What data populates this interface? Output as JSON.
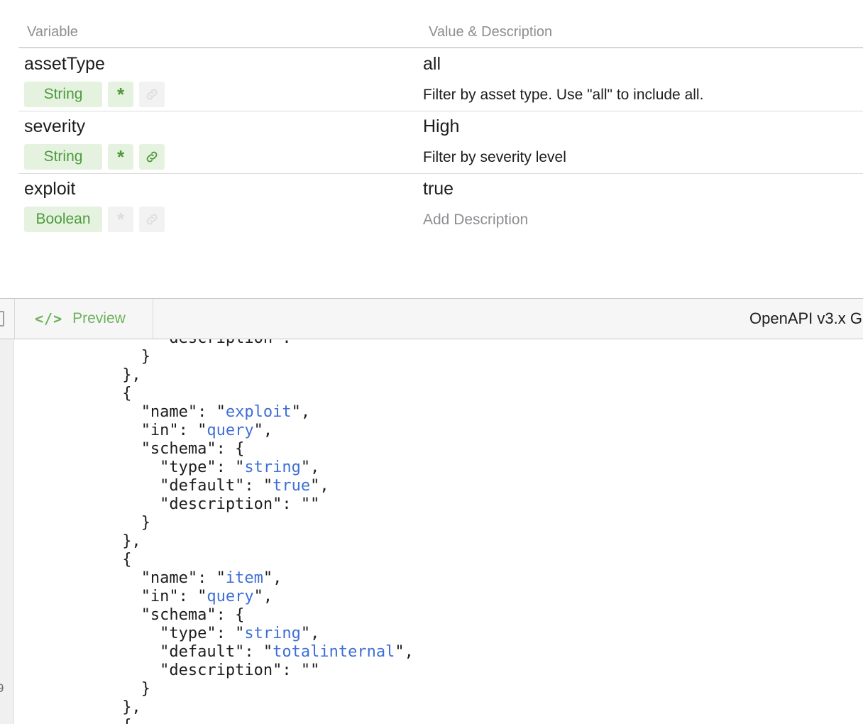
{
  "table": {
    "header_variable": "Variable",
    "header_value": "Value & Description",
    "rows": [
      {
        "name": "assetType",
        "value": "all",
        "type": "String",
        "required": true,
        "linked": false,
        "description": "Filter by asset type. Use \"all\" to include all."
      },
      {
        "name": "severity",
        "value": "High",
        "type": "String",
        "required": true,
        "linked": true,
        "description": "Filter by severity level"
      },
      {
        "name": "exploit",
        "value": "true",
        "type": "Boolean",
        "required": false,
        "linked": false,
        "description": "Add Description"
      }
    ]
  },
  "tabs": {
    "preview_label": "Preview",
    "format_label": "OpenAPI v3.x G"
  },
  "editor": {
    "gutter_number": "9",
    "lines": [
      {
        "indent": 8,
        "key": "description",
        "suffix": ":"
      },
      {
        "indent": 7,
        "text": "}"
      },
      {
        "indent": 6,
        "text": "},"
      },
      {
        "indent": 6,
        "text": "{"
      },
      {
        "indent": 7,
        "key": "name",
        "value": "exploit",
        "suffix": ","
      },
      {
        "indent": 7,
        "key": "in",
        "value": "query",
        "suffix": ","
      },
      {
        "indent": 7,
        "key": "schema",
        "suffix": ": {"
      },
      {
        "indent": 8,
        "key": "type",
        "value": "string",
        "suffix": ","
      },
      {
        "indent": 8,
        "key": "default",
        "value": "true",
        "suffix": ","
      },
      {
        "indent": 8,
        "key": "description",
        "value": "",
        "suffix": ""
      },
      {
        "indent": 7,
        "text": "}"
      },
      {
        "indent": 6,
        "text": "},"
      },
      {
        "indent": 6,
        "text": "{"
      },
      {
        "indent": 7,
        "key": "name",
        "value": "item",
        "suffix": ","
      },
      {
        "indent": 7,
        "key": "in",
        "value": "query",
        "suffix": ","
      },
      {
        "indent": 7,
        "key": "schema",
        "suffix": ": {"
      },
      {
        "indent": 8,
        "key": "type",
        "value": "string",
        "suffix": ","
      },
      {
        "indent": 8,
        "key": "default",
        "value": "totalinternal",
        "suffix": ","
      },
      {
        "indent": 8,
        "key": "description",
        "value": "",
        "suffix": ""
      },
      {
        "indent": 7,
        "text": "}"
      },
      {
        "indent": 6,
        "text": "},"
      },
      {
        "indent": 6,
        "text": "{"
      }
    ]
  },
  "colors": {
    "badge_bg": "#e6f2e0",
    "badge_fg": "#4c9a3c",
    "string_value": "#3e6fd6",
    "tab_accent": "#6bb35a"
  },
  "icons": [
    "asterisk-required-icon",
    "link-icon",
    "code-icon",
    "sidebar-toggle-icon"
  ]
}
